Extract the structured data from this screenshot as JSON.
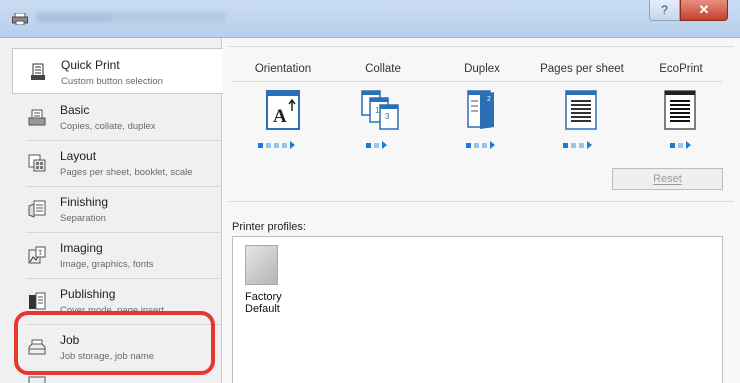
{
  "window": {
    "help_label": "?",
    "close_label": "✕"
  },
  "sidebar": {
    "items": [
      {
        "title": "Quick Print",
        "subtitle": "Custom button selection",
        "icon": "quick-print-icon"
      },
      {
        "title": "Basic",
        "subtitle": "Copies, collate, duplex",
        "icon": "basic-icon"
      },
      {
        "title": "Layout",
        "subtitle": "Pages per sheet, booklet, scale",
        "icon": "layout-icon"
      },
      {
        "title": "Finishing",
        "subtitle": "Separation",
        "icon": "finishing-icon"
      },
      {
        "title": "Imaging",
        "subtitle": "Image, graphics, fonts",
        "icon": "imaging-icon"
      },
      {
        "title": "Publishing",
        "subtitle": "Cover mode, page insert",
        "icon": "publishing-icon"
      },
      {
        "title": "Job",
        "subtitle": "Job storage, job name",
        "icon": "job-icon"
      }
    ]
  },
  "quick_print": {
    "columns": [
      "Orientation",
      "Collate",
      "Duplex",
      "Pages per sheet",
      "EcoPrint"
    ],
    "reset_label": "Reset",
    "profiles_label": "Printer profiles:",
    "profiles": [
      {
        "name_line1": "Factory",
        "name_line2": "Default"
      }
    ]
  },
  "colors": {
    "accent": "#1e78d6",
    "highlight_ring": "#e8382e"
  }
}
